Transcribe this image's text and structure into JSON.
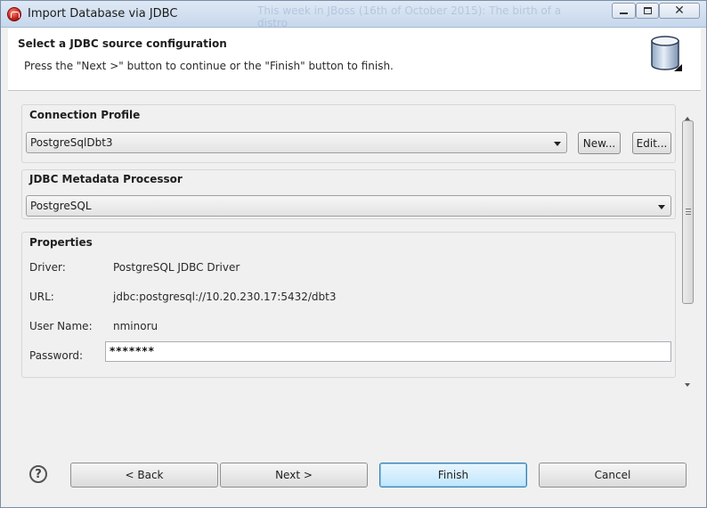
{
  "window": {
    "title": "Import Database via JDBC",
    "background_title": "This week in JBoss (16th of October 2015): The birth of a distro"
  },
  "header": {
    "title": "Select a JDBC source configuration",
    "description": "Press the \"Next >\" button to continue or the \"Finish\" button to finish.",
    "icon": "database-icon"
  },
  "connection_profile": {
    "label": "Connection Profile",
    "selected": "PostgreSqlDbt3",
    "new_label": "New...",
    "edit_label": "Edit..."
  },
  "metadata_processor": {
    "label": "JDBC Metadata Processor",
    "selected": "PostgreSQL"
  },
  "properties": {
    "label": "Properties",
    "driver_label": "Driver:",
    "driver_value": "PostgreSQL JDBC Driver",
    "url_label": "URL:",
    "url_value": "jdbc:postgresql://10.20.230.17:5432/dbt3",
    "user_label": "User Name:",
    "user_value": "nminoru",
    "password_label": "Password:",
    "password_value": "*******"
  },
  "footer": {
    "help_icon": "help-icon",
    "back_label": "< Back",
    "next_label": "Next >",
    "finish_label": "Finish",
    "cancel_label": "Cancel"
  },
  "colors": {
    "accent_default_button": "#bee6fd",
    "titlebar": "#c6d7ec",
    "header_bg": "#ffffff"
  }
}
